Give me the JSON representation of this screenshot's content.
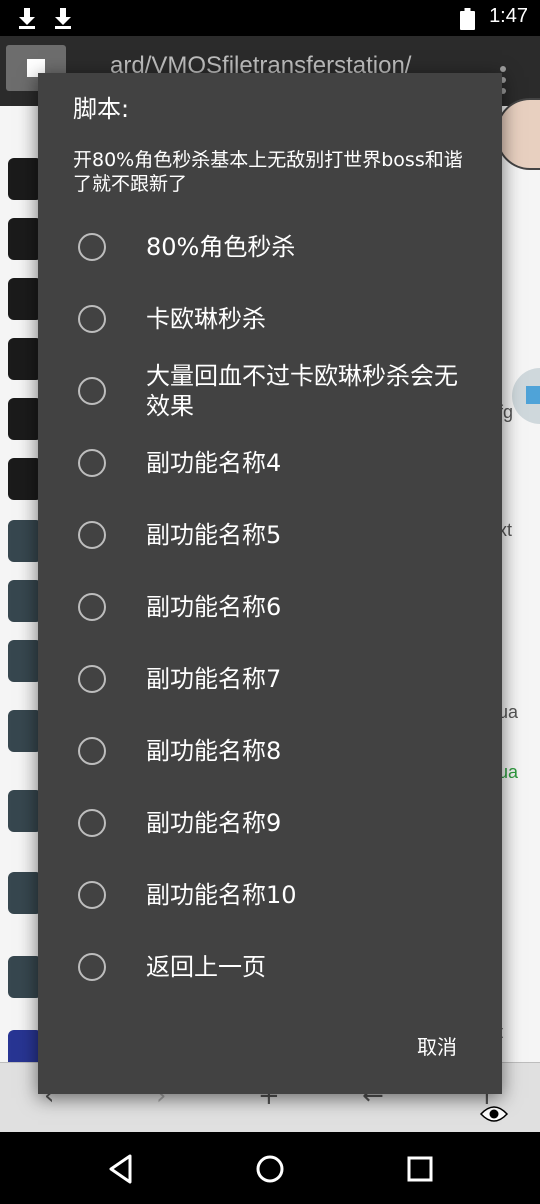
{
  "status_bar": {
    "time": "1:47",
    "icons": [
      "download-icon",
      "download-icon",
      "battery-icon"
    ]
  },
  "background": {
    "path_text": "ard/VMOSfiletransferstation/",
    "side_fragments": [
      "fg",
      "xt",
      "ua",
      "ua",
      "t"
    ]
  },
  "dialog": {
    "title": "脚本:",
    "message": "开80%角色秒杀基本上无敌别打世界boss和谐了就不跟新了",
    "options": [
      {
        "label": "80%角色秒杀",
        "selected": false
      },
      {
        "label": "卡欧琳秒杀",
        "selected": false
      },
      {
        "label": "大量回血不过卡欧琳秒杀会无效果",
        "selected": false
      },
      {
        "label": "副功能名称4",
        "selected": false
      },
      {
        "label": "副功能名称5",
        "selected": false
      },
      {
        "label": "副功能名称6",
        "selected": false
      },
      {
        "label": "副功能名称7",
        "selected": false
      },
      {
        "label": "副功能名称8",
        "selected": false
      },
      {
        "label": "副功能名称9",
        "selected": false
      },
      {
        "label": "副功能名称10",
        "selected": false
      },
      {
        "label": "返回上一页",
        "selected": false
      }
    ],
    "cancel_label": "取消"
  },
  "nav_bar": {
    "icons": [
      "back-icon",
      "home-icon",
      "recents-icon"
    ]
  }
}
